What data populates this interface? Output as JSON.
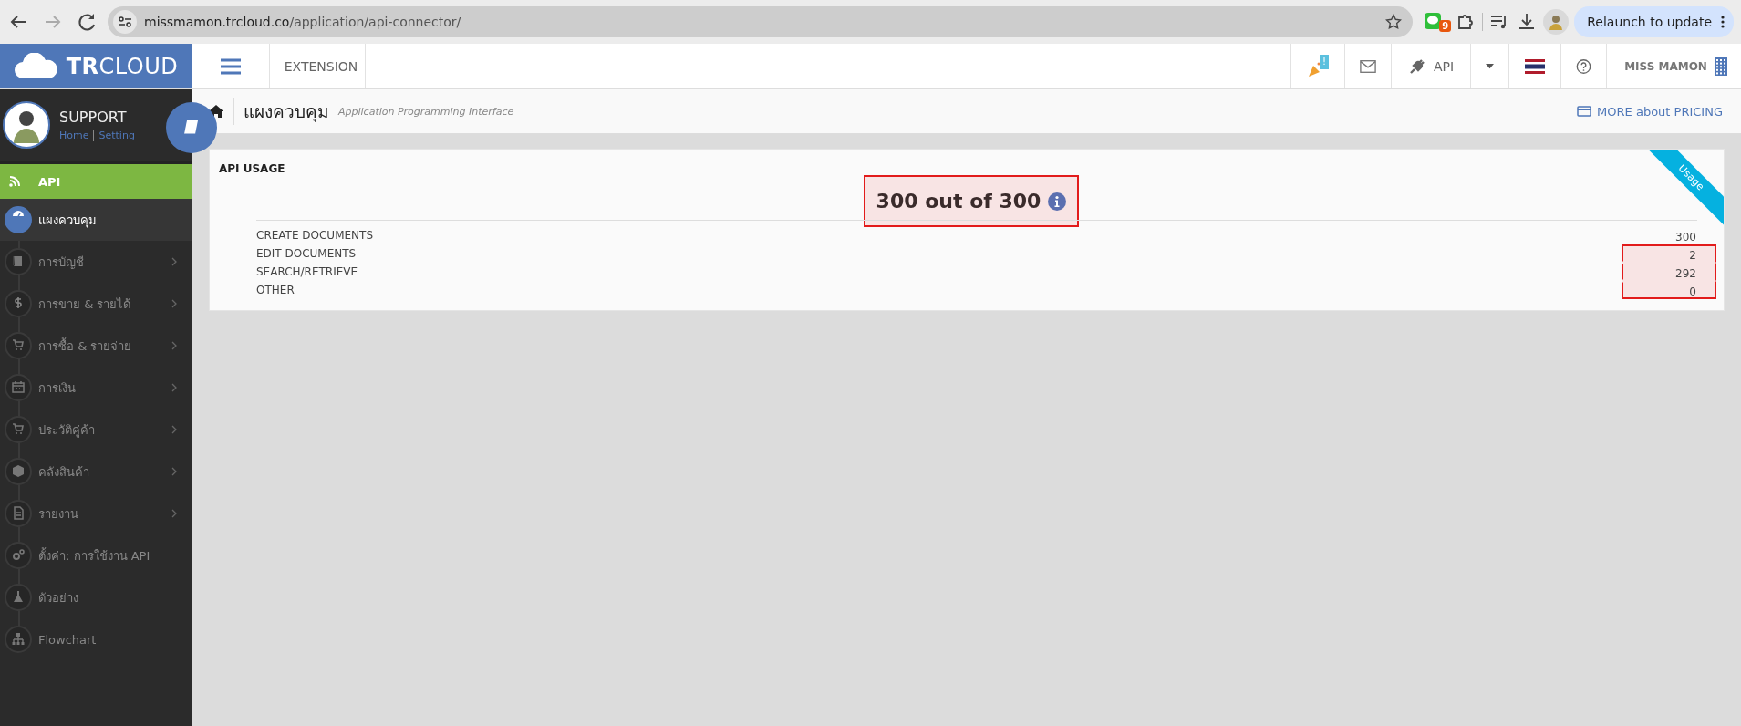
{
  "browser": {
    "url_host": "missmamon.trcloud.co",
    "url_path": "/application/api-connector/",
    "extension_badge": "9",
    "relaunch_button": "Relaunch to update"
  },
  "header": {
    "logo": "**TR**CLOUD",
    "extension_label": "EXTENSION",
    "notification_badge": "!",
    "api_label": "API",
    "user_name": "MISS MAMON"
  },
  "profile": {
    "name": "SUPPORT",
    "links": [
      "Home",
      "Setting"
    ]
  },
  "sidebar": {
    "section": "API",
    "items": [
      {
        "label": "แผงควบคุม",
        "selected": true,
        "has_submenu": false
      },
      {
        "label": "การบัญชี",
        "selected": false,
        "has_submenu": true
      },
      {
        "label": "การขาย & รายได้",
        "selected": false,
        "has_submenu": true
      },
      {
        "label": "การซื้อ & รายจ่าย",
        "selected": false,
        "has_submenu": true
      },
      {
        "label": "การเงิน",
        "selected": false,
        "has_submenu": true
      },
      {
        "label": "ประวัติคู่ค้า",
        "selected": false,
        "has_submenu": true
      },
      {
        "label": "คลังสินค้า",
        "selected": false,
        "has_submenu": true
      },
      {
        "label": "รายงาน",
        "selected": false,
        "has_submenu": true
      },
      {
        "label": "ตั้งค่า: การใช้งาน API",
        "selected": false,
        "has_submenu": false
      },
      {
        "label": "ตัวอย่าง",
        "selected": false,
        "has_submenu": false
      },
      {
        "label": "Flowchart",
        "selected": false,
        "has_submenu": false
      }
    ]
  },
  "breadcrumb": {
    "title": "แผงควบคุม",
    "subtitle": "Application Programming Interface",
    "pricing_link": "MORE about PRICING"
  },
  "usage_card": {
    "title": "API USAGE",
    "ribbon": "Usage",
    "total": "300 out of 300",
    "total_highlighted": true,
    "rows": [
      {
        "label": "CREATE DOCUMENTS",
        "value": "300",
        "highlighted": false
      },
      {
        "label": "EDIT DOCUMENTS",
        "value": "2",
        "highlighted": true
      },
      {
        "label": "SEARCH/RETRIEVE",
        "value": "292",
        "highlighted": true
      },
      {
        "label": "OTHER",
        "value": "0",
        "highlighted": true
      }
    ]
  }
}
